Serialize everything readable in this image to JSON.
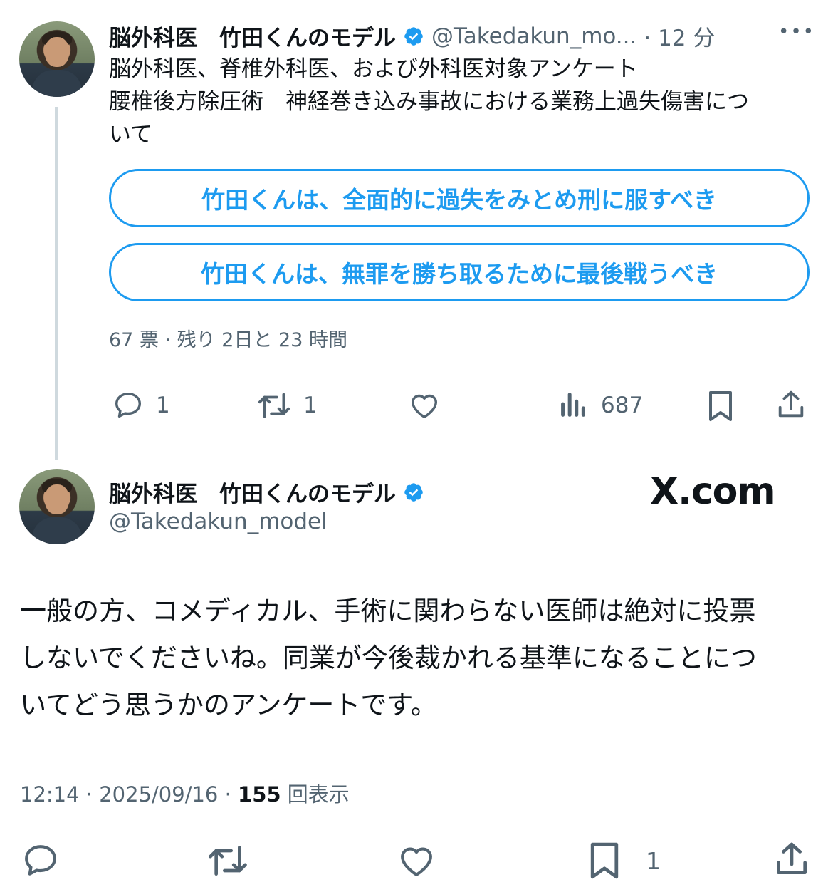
{
  "tweet1": {
    "display_name": "脳外科医　竹田くんのモデル",
    "handle": "@Takedakun_mo...",
    "time": "· 12 分",
    "more": "•••",
    "text_lines": [
      "脳外科医、脊椎外科医、および外科医対象アンケート",
      "腰椎後方除圧術　神経巻き込み事故における業務上過失傷害につ",
      "いて"
    ],
    "poll": {
      "options": [
        "竹田くんは、全面的に過失をみとめ刑に服すべき",
        "竹田くんは、無罪を勝ち取るために最後戦うべき"
      ],
      "meta": "67 票 · 残り 2日と 23 時間"
    },
    "actions": {
      "reply_count": "1",
      "repost_count": "1",
      "views_count": "687"
    }
  },
  "tweet2": {
    "display_name": "脳外科医　竹田くんのモデル",
    "handle": "@Takedakun_model",
    "watermark": "X.com",
    "text_lines": [
      "一般の方、コメディカル、手術に関わらない医師は絶対に投票",
      "しないでくださいね。同業が今後裁かれる基準になることにつ",
      "いてどう思うかのアンケートです。"
    ],
    "time": "12:14 · 2025/09/16 · ",
    "views_count": "155",
    "views_label": " 回表示",
    "bookmark_count": "1"
  },
  "colors": {
    "accent": "#1d9bf0",
    "text": "#0f1419",
    "muted": "#536471",
    "thread_line": "#cfd9de"
  },
  "icons": [
    "verified-badge-icon",
    "more-icon",
    "reply-icon",
    "repost-icon",
    "like-icon",
    "views-icon",
    "bookmark-icon",
    "share-icon"
  ]
}
